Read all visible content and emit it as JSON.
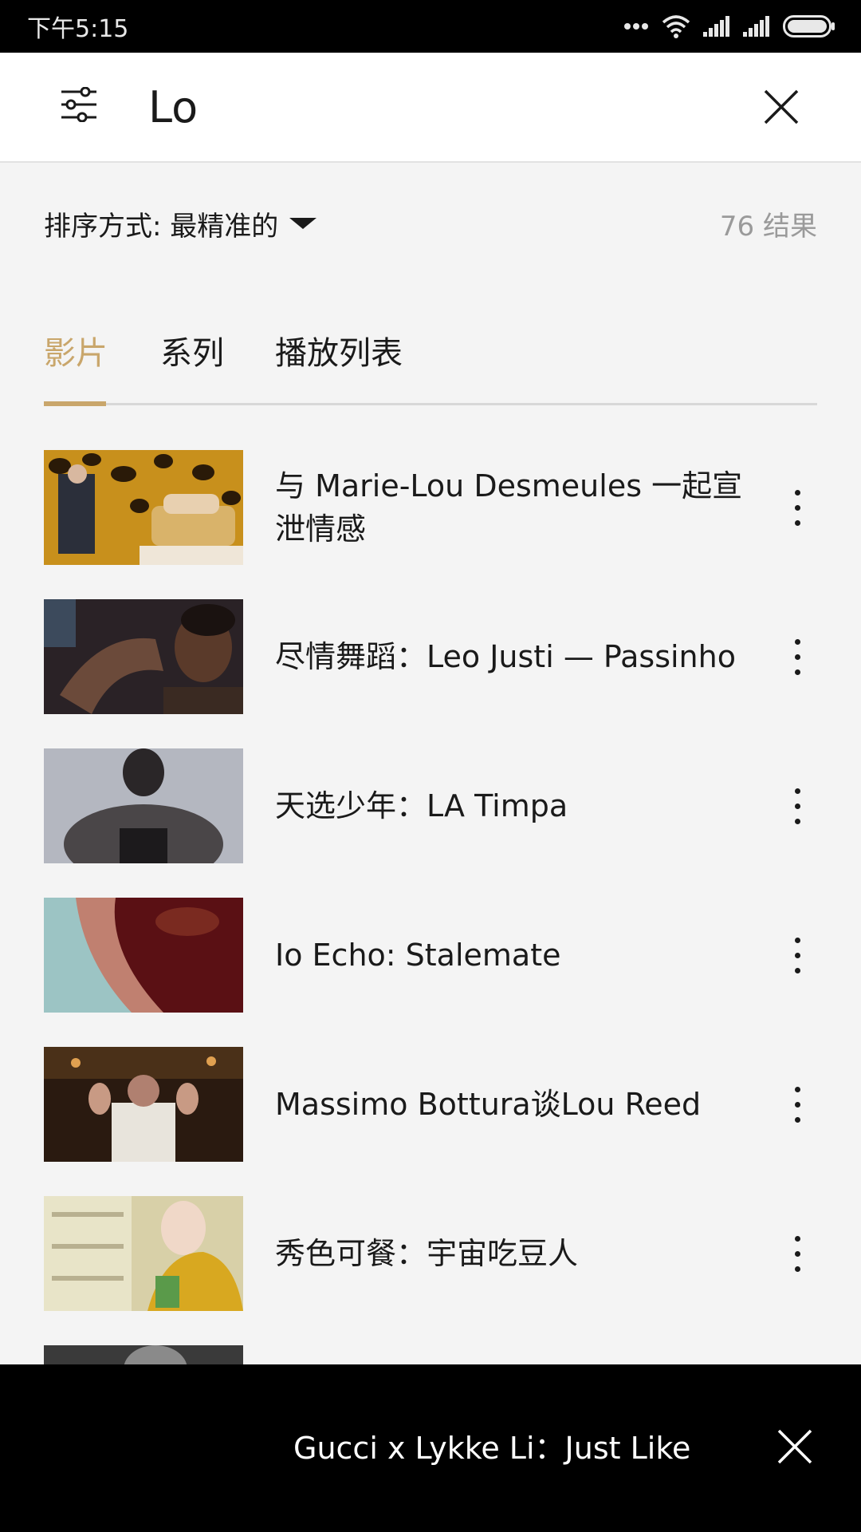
{
  "status_bar": {
    "time": "下午5:15",
    "icons": [
      "more-dots-icon",
      "wifi-icon",
      "signal-icon",
      "signal-icon",
      "battery-icon"
    ]
  },
  "search": {
    "query": "Lo",
    "filter_icon": "sliders-icon",
    "clear_icon": "close-icon"
  },
  "sort": {
    "label": "排序方式: 最精准的",
    "result_count": "76 结果"
  },
  "tabs": [
    {
      "label": "影片",
      "active": true
    },
    {
      "label": "系列",
      "active": false
    },
    {
      "label": "播放列表",
      "active": false
    }
  ],
  "results": [
    {
      "title": "与 Marie-Lou Desmeules 一起宣泄情感"
    },
    {
      "title": "尽情舞蹈：Leo Justi — Passinho"
    },
    {
      "title": "天选少年：LA Timpa"
    },
    {
      "title": "Io Echo: Stalemate"
    },
    {
      "title": "Massimo Bottura谈Lou Reed"
    },
    {
      "title": "秀色可餐：宇宙吃豆人"
    }
  ],
  "mini_player": {
    "title": "Gucci x Lykke Li：Just Like"
  },
  "colors": {
    "accent": "#c9a66b",
    "background": "#f4f4f4",
    "header": "#ffffff",
    "player": "#000000"
  }
}
